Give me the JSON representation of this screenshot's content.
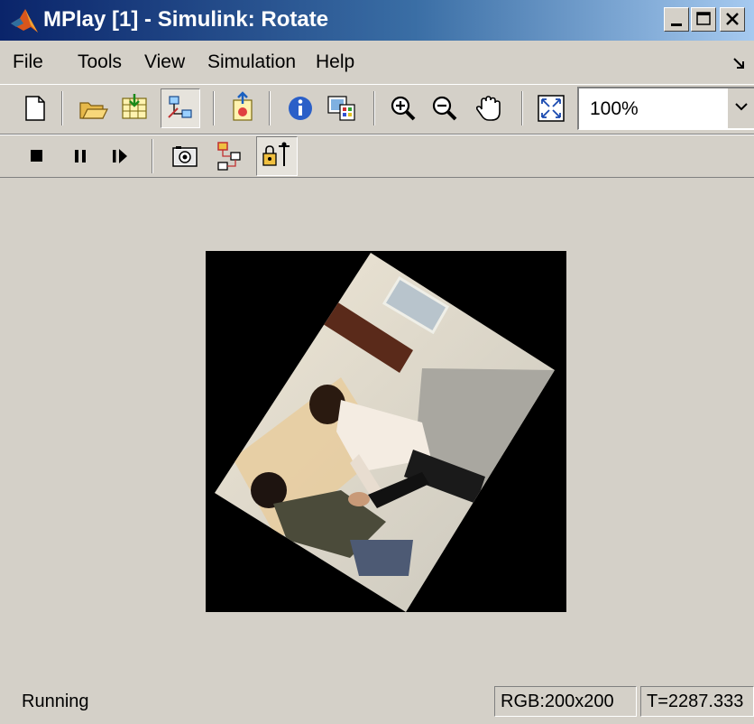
{
  "window": {
    "title": "MPlay [1] - Simulink: Rotate",
    "controls": [
      "minimize-icon",
      "maximize-icon",
      "close-icon"
    ]
  },
  "menu": {
    "items": [
      {
        "label": "File"
      },
      {
        "label": "Tools"
      },
      {
        "label": "View"
      },
      {
        "label": "Simulation"
      },
      {
        "label": "Help"
      }
    ]
  },
  "toolbar_main": {
    "buttons": [
      {
        "icon": "new-document-icon"
      },
      {
        "icon": "open-folder-icon"
      },
      {
        "icon": "import-icon"
      },
      {
        "icon": "connect-to-model-icon",
        "pressed": true
      },
      {
        "icon": "export-icon"
      },
      {
        "icon": "info-icon"
      },
      {
        "icon": "colormap-icon"
      },
      {
        "icon": "zoom-in-icon"
      },
      {
        "icon": "zoom-out-icon"
      },
      {
        "icon": "pan-hand-icon"
      },
      {
        "icon": "fit-to-window-icon"
      }
    ],
    "zoom": {
      "value": "100%"
    }
  },
  "toolbar_playback": {
    "buttons": [
      {
        "icon": "stop-icon"
      },
      {
        "icon": "pause-icon"
      },
      {
        "icon": "step-forward-icon"
      },
      {
        "icon": "snapshot-camera-icon"
      },
      {
        "icon": "highlight-block-icon"
      },
      {
        "icon": "lock-scope-icon",
        "pressed": true
      }
    ]
  },
  "video": {
    "description_colors": {
      "background": "#000000",
      "wall": "#cdcbc4",
      "floor": "#9a9a8e"
    }
  },
  "status": {
    "state": "Running",
    "format": "RGB:200x200",
    "time": "T=2287.333"
  },
  "colors": {
    "titlebar_start": "#0a246a",
    "titlebar_end": "#a6caf0",
    "face": "#d4d0c8"
  }
}
